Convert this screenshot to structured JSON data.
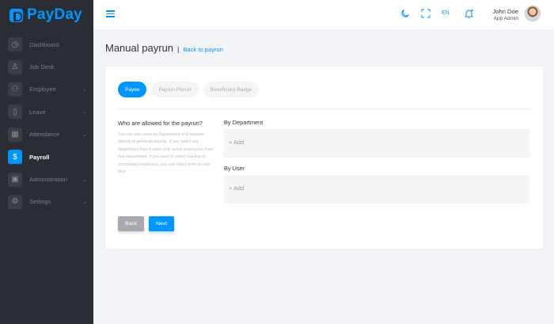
{
  "brand": {
    "name": "PayDay",
    "color": "#0096ff",
    "icon": "payday-logo-icon"
  },
  "sidebar": {
    "items": [
      {
        "label": "Dashboard",
        "icon": "clock-icon",
        "glyph": "◷",
        "chevron": false,
        "active": false
      },
      {
        "label": "Job Desk",
        "icon": "person-icon",
        "glyph": "♙",
        "chevron": false,
        "active": false
      },
      {
        "label": "Employee",
        "icon": "users-icon",
        "glyph": "⚇",
        "chevron": true,
        "active": false
      },
      {
        "label": "Leave",
        "icon": "leave-icon",
        "glyph": "▯",
        "chevron": true,
        "active": false
      },
      {
        "label": "Attendance",
        "icon": "calendar-icon",
        "glyph": "▦",
        "chevron": true,
        "active": false
      },
      {
        "label": "Payroll",
        "icon": "dollar-icon",
        "glyph": "$",
        "chevron": false,
        "active": true
      },
      {
        "label": "Administration",
        "icon": "briefcase-icon",
        "glyph": "▣",
        "chevron": true,
        "active": false
      },
      {
        "label": "Settings",
        "icon": "gear-icon",
        "glyph": "⚙",
        "chevron": true,
        "active": false
      }
    ]
  },
  "topbar": {
    "lang": "EN",
    "user_name": "John Doe",
    "user_role": "App Admin"
  },
  "page": {
    "title": "Manual payrun",
    "separator": "|",
    "back_link": "Back to payrun"
  },
  "tabs": [
    "Payee",
    "Payrun Period",
    "Beneficiary Badge"
  ],
  "form": {
    "question": "Who are allowed for the payrun?",
    "description": "You can add users by Department or Employee directly to generate payslip. If you select any department then it takes only active employees from that department. If you need to select inactive or terminated employees, you can select from by user filed",
    "by_department_label": "By Department",
    "by_user_label": "By User",
    "add_label": "+ Add"
  },
  "buttons": {
    "back": "Back",
    "next": "Next"
  }
}
